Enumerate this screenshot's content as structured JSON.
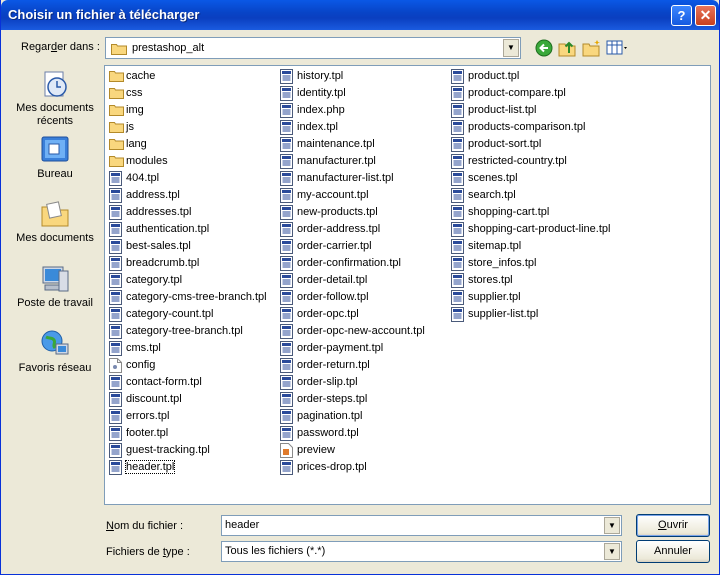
{
  "window": {
    "title": "Choisir un fichier à télécharger",
    "help_label": "?",
    "close_label": "✕"
  },
  "lookin": {
    "label": "Regarder dans :",
    "value": "prestashop_alt"
  },
  "places": [
    {
      "label": "Mes documents récents",
      "icon": "recent-documents-icon"
    },
    {
      "label": "Bureau",
      "icon": "desktop-icon"
    },
    {
      "label": "Mes documents",
      "icon": "my-documents-icon"
    },
    {
      "label": "Poste de travail",
      "icon": "my-computer-icon"
    },
    {
      "label": "Favoris réseau",
      "icon": "network-places-icon"
    }
  ],
  "files": {
    "col1": [
      {
        "name": "cache",
        "type": "folder"
      },
      {
        "name": "css",
        "type": "folder"
      },
      {
        "name": "img",
        "type": "folder"
      },
      {
        "name": "js",
        "type": "folder"
      },
      {
        "name": "lang",
        "type": "folder"
      },
      {
        "name": "modules",
        "type": "folder"
      },
      {
        "name": "404.tpl",
        "type": "tpl"
      },
      {
        "name": "address.tpl",
        "type": "tpl"
      },
      {
        "name": "addresses.tpl",
        "type": "tpl"
      },
      {
        "name": "authentication.tpl",
        "type": "tpl"
      },
      {
        "name": "best-sales.tpl",
        "type": "tpl"
      },
      {
        "name": "breadcrumb.tpl",
        "type": "tpl"
      },
      {
        "name": "category.tpl",
        "type": "tpl"
      },
      {
        "name": "category-cms-tree-branch.tpl",
        "type": "tpl"
      },
      {
        "name": "category-count.tpl",
        "type": "tpl"
      },
      {
        "name": "category-tree-branch.tpl",
        "type": "tpl"
      },
      {
        "name": "cms.tpl",
        "type": "tpl"
      },
      {
        "name": "config",
        "type": "config"
      },
      {
        "name": "contact-form.tpl",
        "type": "tpl"
      },
      {
        "name": "discount.tpl",
        "type": "tpl"
      },
      {
        "name": "errors.tpl",
        "type": "tpl"
      },
      {
        "name": "footer.tpl",
        "type": "tpl"
      },
      {
        "name": "guest-tracking.tpl",
        "type": "tpl"
      },
      {
        "name": "header.tpl",
        "type": "tpl",
        "selected": true
      }
    ],
    "col2": [
      {
        "name": "history.tpl",
        "type": "tpl"
      },
      {
        "name": "identity.tpl",
        "type": "tpl"
      },
      {
        "name": "index.php",
        "type": "tpl"
      },
      {
        "name": "index.tpl",
        "type": "tpl"
      },
      {
        "name": "maintenance.tpl",
        "type": "tpl"
      },
      {
        "name": "manufacturer.tpl",
        "type": "tpl"
      },
      {
        "name": "manufacturer-list.tpl",
        "type": "tpl"
      },
      {
        "name": "my-account.tpl",
        "type": "tpl"
      },
      {
        "name": "new-products.tpl",
        "type": "tpl"
      },
      {
        "name": "order-address.tpl",
        "type": "tpl"
      },
      {
        "name": "order-carrier.tpl",
        "type": "tpl"
      },
      {
        "name": "order-confirmation.tpl",
        "type": "tpl"
      },
      {
        "name": "order-detail.tpl",
        "type": "tpl"
      },
      {
        "name": "order-follow.tpl",
        "type": "tpl"
      },
      {
        "name": "order-opc.tpl",
        "type": "tpl"
      },
      {
        "name": "order-opc-new-account.tpl",
        "type": "tpl"
      },
      {
        "name": "order-payment.tpl",
        "type": "tpl"
      },
      {
        "name": "order-return.tpl",
        "type": "tpl"
      },
      {
        "name": "order-slip.tpl",
        "type": "tpl"
      },
      {
        "name": "order-steps.tpl",
        "type": "tpl"
      },
      {
        "name": "pagination.tpl",
        "type": "tpl"
      },
      {
        "name": "password.tpl",
        "type": "tpl"
      },
      {
        "name": "preview",
        "type": "preview"
      },
      {
        "name": "prices-drop.tpl",
        "type": "tpl"
      }
    ],
    "col3": [
      {
        "name": "product.tpl",
        "type": "tpl"
      },
      {
        "name": "product-compare.tpl",
        "type": "tpl"
      },
      {
        "name": "product-list.tpl",
        "type": "tpl"
      },
      {
        "name": "products-comparison.tpl",
        "type": "tpl"
      },
      {
        "name": "product-sort.tpl",
        "type": "tpl"
      },
      {
        "name": "restricted-country.tpl",
        "type": "tpl"
      },
      {
        "name": "scenes.tpl",
        "type": "tpl"
      },
      {
        "name": "search.tpl",
        "type": "tpl"
      },
      {
        "name": "shopping-cart.tpl",
        "type": "tpl"
      },
      {
        "name": "shopping-cart-product-line.tpl",
        "type": "tpl"
      },
      {
        "name": "sitemap.tpl",
        "type": "tpl"
      },
      {
        "name": "store_infos.tpl",
        "type": "tpl"
      },
      {
        "name": "stores.tpl",
        "type": "tpl"
      },
      {
        "name": "supplier.tpl",
        "type": "tpl"
      },
      {
        "name": "supplier-list.tpl",
        "type": "tpl"
      }
    ]
  },
  "filename": {
    "label": "Nom du fichier :",
    "value": "header"
  },
  "filetype": {
    "label": "Fichiers de type :",
    "value": "Tous les fichiers (*.*)"
  },
  "buttons": {
    "open": "Ouvrir",
    "cancel": "Annuler"
  }
}
